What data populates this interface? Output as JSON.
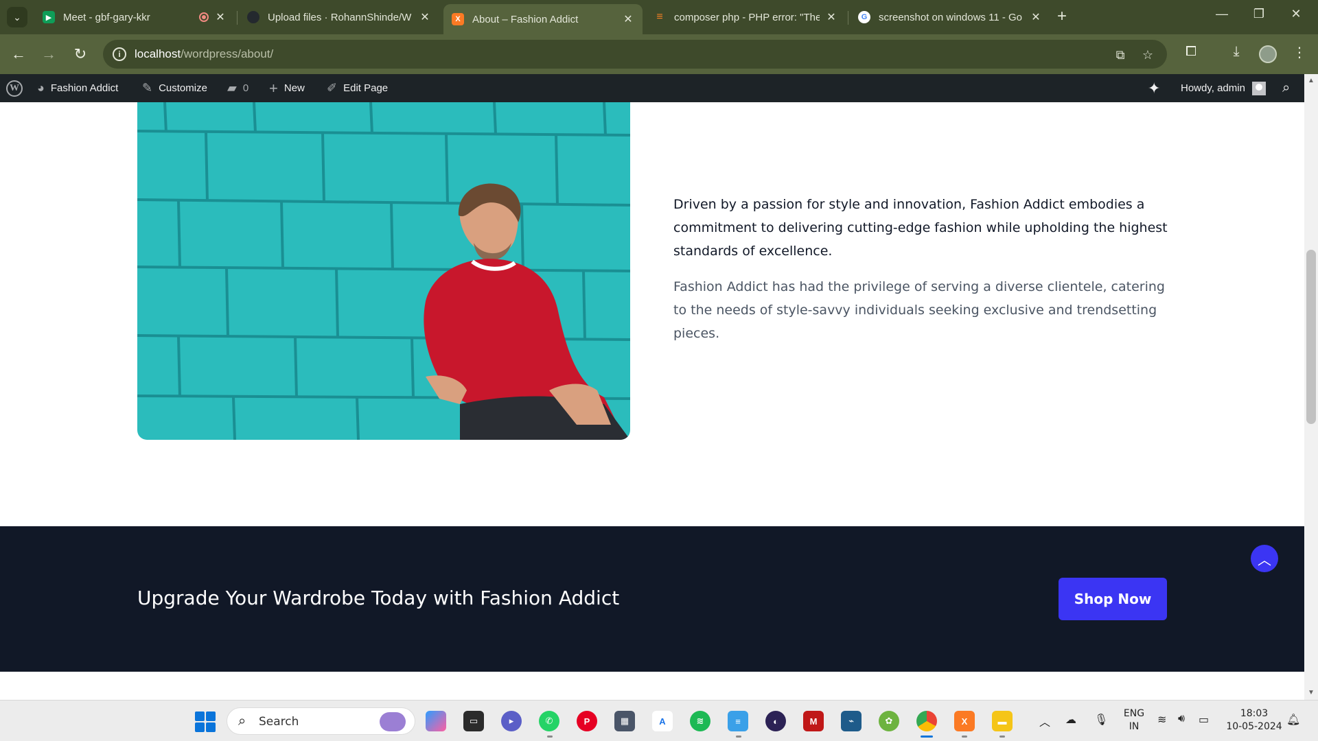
{
  "browser": {
    "tabs": [
      {
        "title": "Meet - gbf-gary-kkr",
        "favicon": "google-meet-icon",
        "recording": true,
        "active": false
      },
      {
        "title": "Upload files · RohannShinde/W",
        "favicon": "github-icon",
        "active": false
      },
      {
        "title": "About – Fashion Addict",
        "favicon": "xampp-icon",
        "active": true
      },
      {
        "title": "composer php - PHP error: \"The",
        "favicon": "stackoverflow-icon",
        "active": false
      },
      {
        "title": "screenshot on windows 11 - Go",
        "favicon": "google-icon",
        "active": false
      }
    ],
    "url_host": "localhost",
    "url_path": "/wordpress/about/"
  },
  "admin_bar": {
    "site_name": "Fashion Addict",
    "customize": "Customize",
    "comments_count": "0",
    "new": "New",
    "edit_page": "Edit Page",
    "howdy": "Howdy, admin"
  },
  "about": {
    "lead": "Driven by a passion for style and innovation, Fashion Addict embodies a commitment to delivering cutting-edge fashion while upholding the highest standards of excellence.",
    "body": "Fashion Addict has had the privilege of serving a diverse clientele, catering to the needs of style-savvy individuals seeking exclusive and trendsetting pieces."
  },
  "cta": {
    "title": "Upgrade Your Wardrobe Today with Fashion Addict",
    "button": "Shop Now"
  },
  "taskbar": {
    "search_label": "Search",
    "language": "ENG",
    "region": "IN",
    "time": "18:03",
    "date": "10-05-2024",
    "pinned_apps": [
      "copilot-icon",
      "terminal-icon",
      "teams-icon",
      "whatsapp-icon",
      "pinterest-icon",
      "calculator-icon",
      "text-editor-icon",
      "spotify-icon",
      "notepad-icon",
      "eclipse-icon",
      "mcafee-icon",
      "mysql-workbench-icon",
      "spring-icon",
      "chrome-icon",
      "xampp-icon",
      "file-explorer-icon"
    ]
  },
  "colors": {
    "accent": "#3b35f3",
    "cta_background": "#111827",
    "admin_bar": "#1d2327",
    "browser_frame": "#56633d"
  }
}
